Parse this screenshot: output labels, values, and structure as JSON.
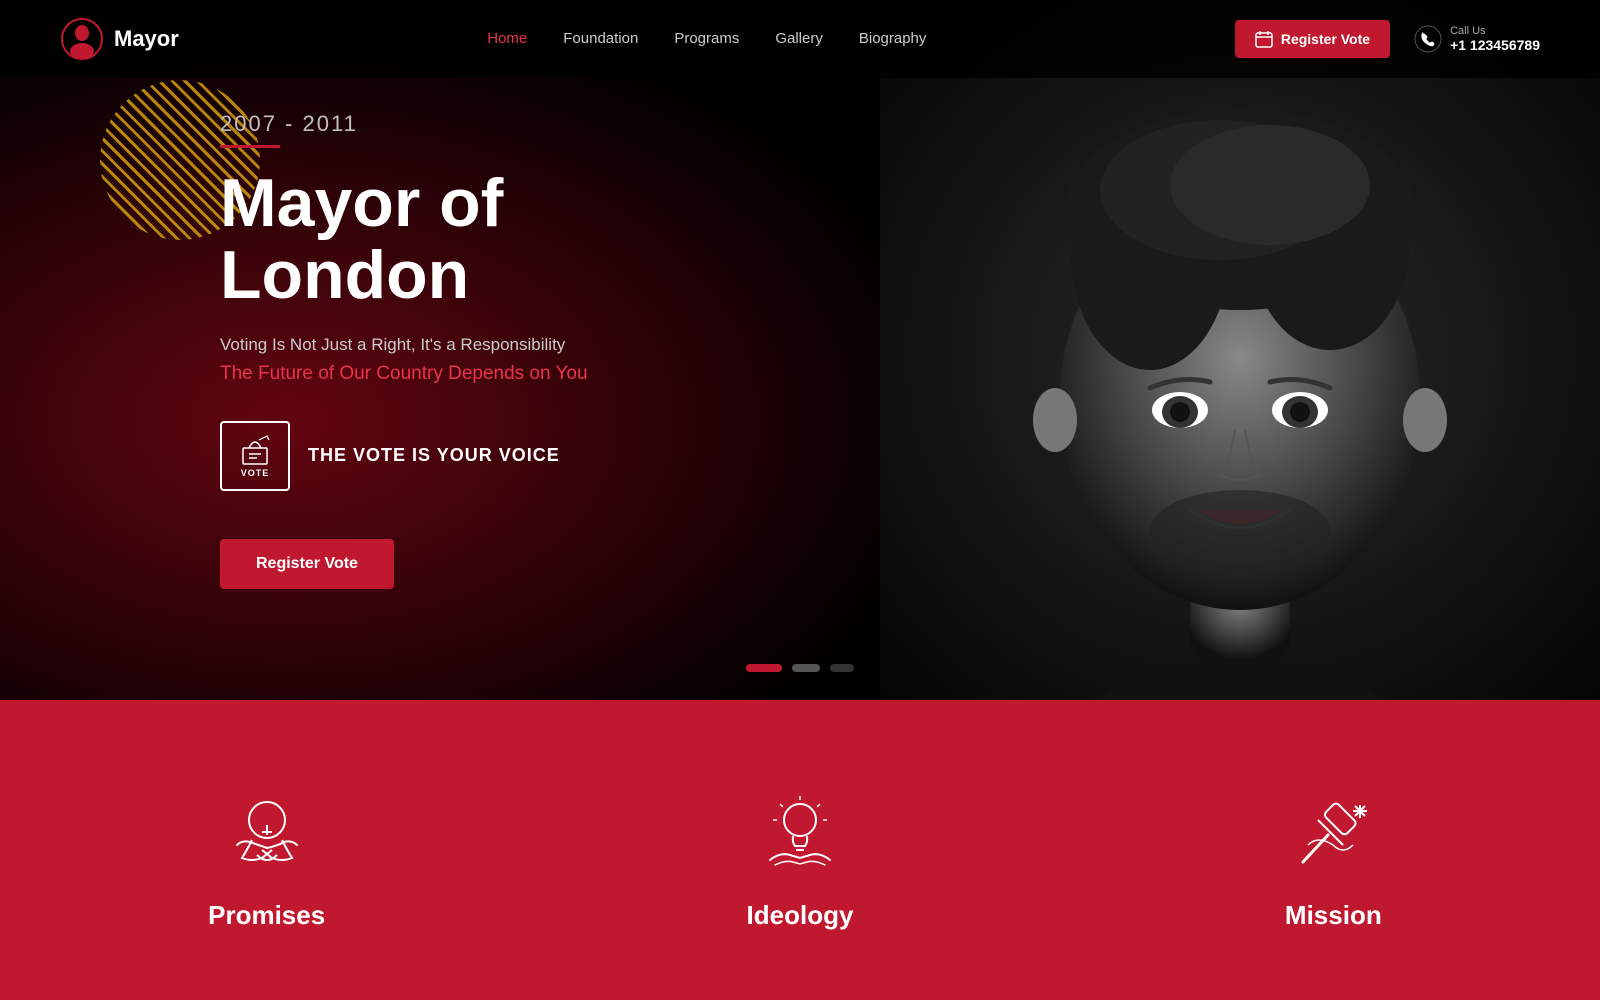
{
  "navbar": {
    "brand": {
      "name": "Mayor",
      "icon": "mayor-icon"
    },
    "nav": [
      {
        "label": "Home",
        "active": true,
        "href": "#"
      },
      {
        "label": "Foundation",
        "active": false,
        "href": "#"
      },
      {
        "label": "Programs",
        "active": false,
        "href": "#"
      },
      {
        "label": "Gallery",
        "active": false,
        "href": "#"
      },
      {
        "label": "Biography",
        "active": false,
        "href": "#"
      }
    ],
    "register_vote_label": "Register Vote",
    "call_us_label": "Call Us",
    "phone": "+1 123456789"
  },
  "hero": {
    "year_range": "2007 - 2011",
    "title": "Mayor of London",
    "subtitle": "Voting Is Not Just a Right, It's a Responsibility",
    "tagline": "The Future of Our Country Depends on You",
    "vote_label": "VOTE",
    "vote_text": "THE VOTE IS YOUR VOICE",
    "register_btn": "Register Vote"
  },
  "slider": {
    "dots": [
      {
        "active": true
      },
      {
        "active": false
      },
      {
        "active": false
      }
    ]
  },
  "bottom_cards": [
    {
      "label": "Promises",
      "icon": "promises-icon"
    },
    {
      "label": "Ideology",
      "icon": "ideology-icon"
    },
    {
      "label": "Mission",
      "icon": "mission-icon"
    }
  ]
}
